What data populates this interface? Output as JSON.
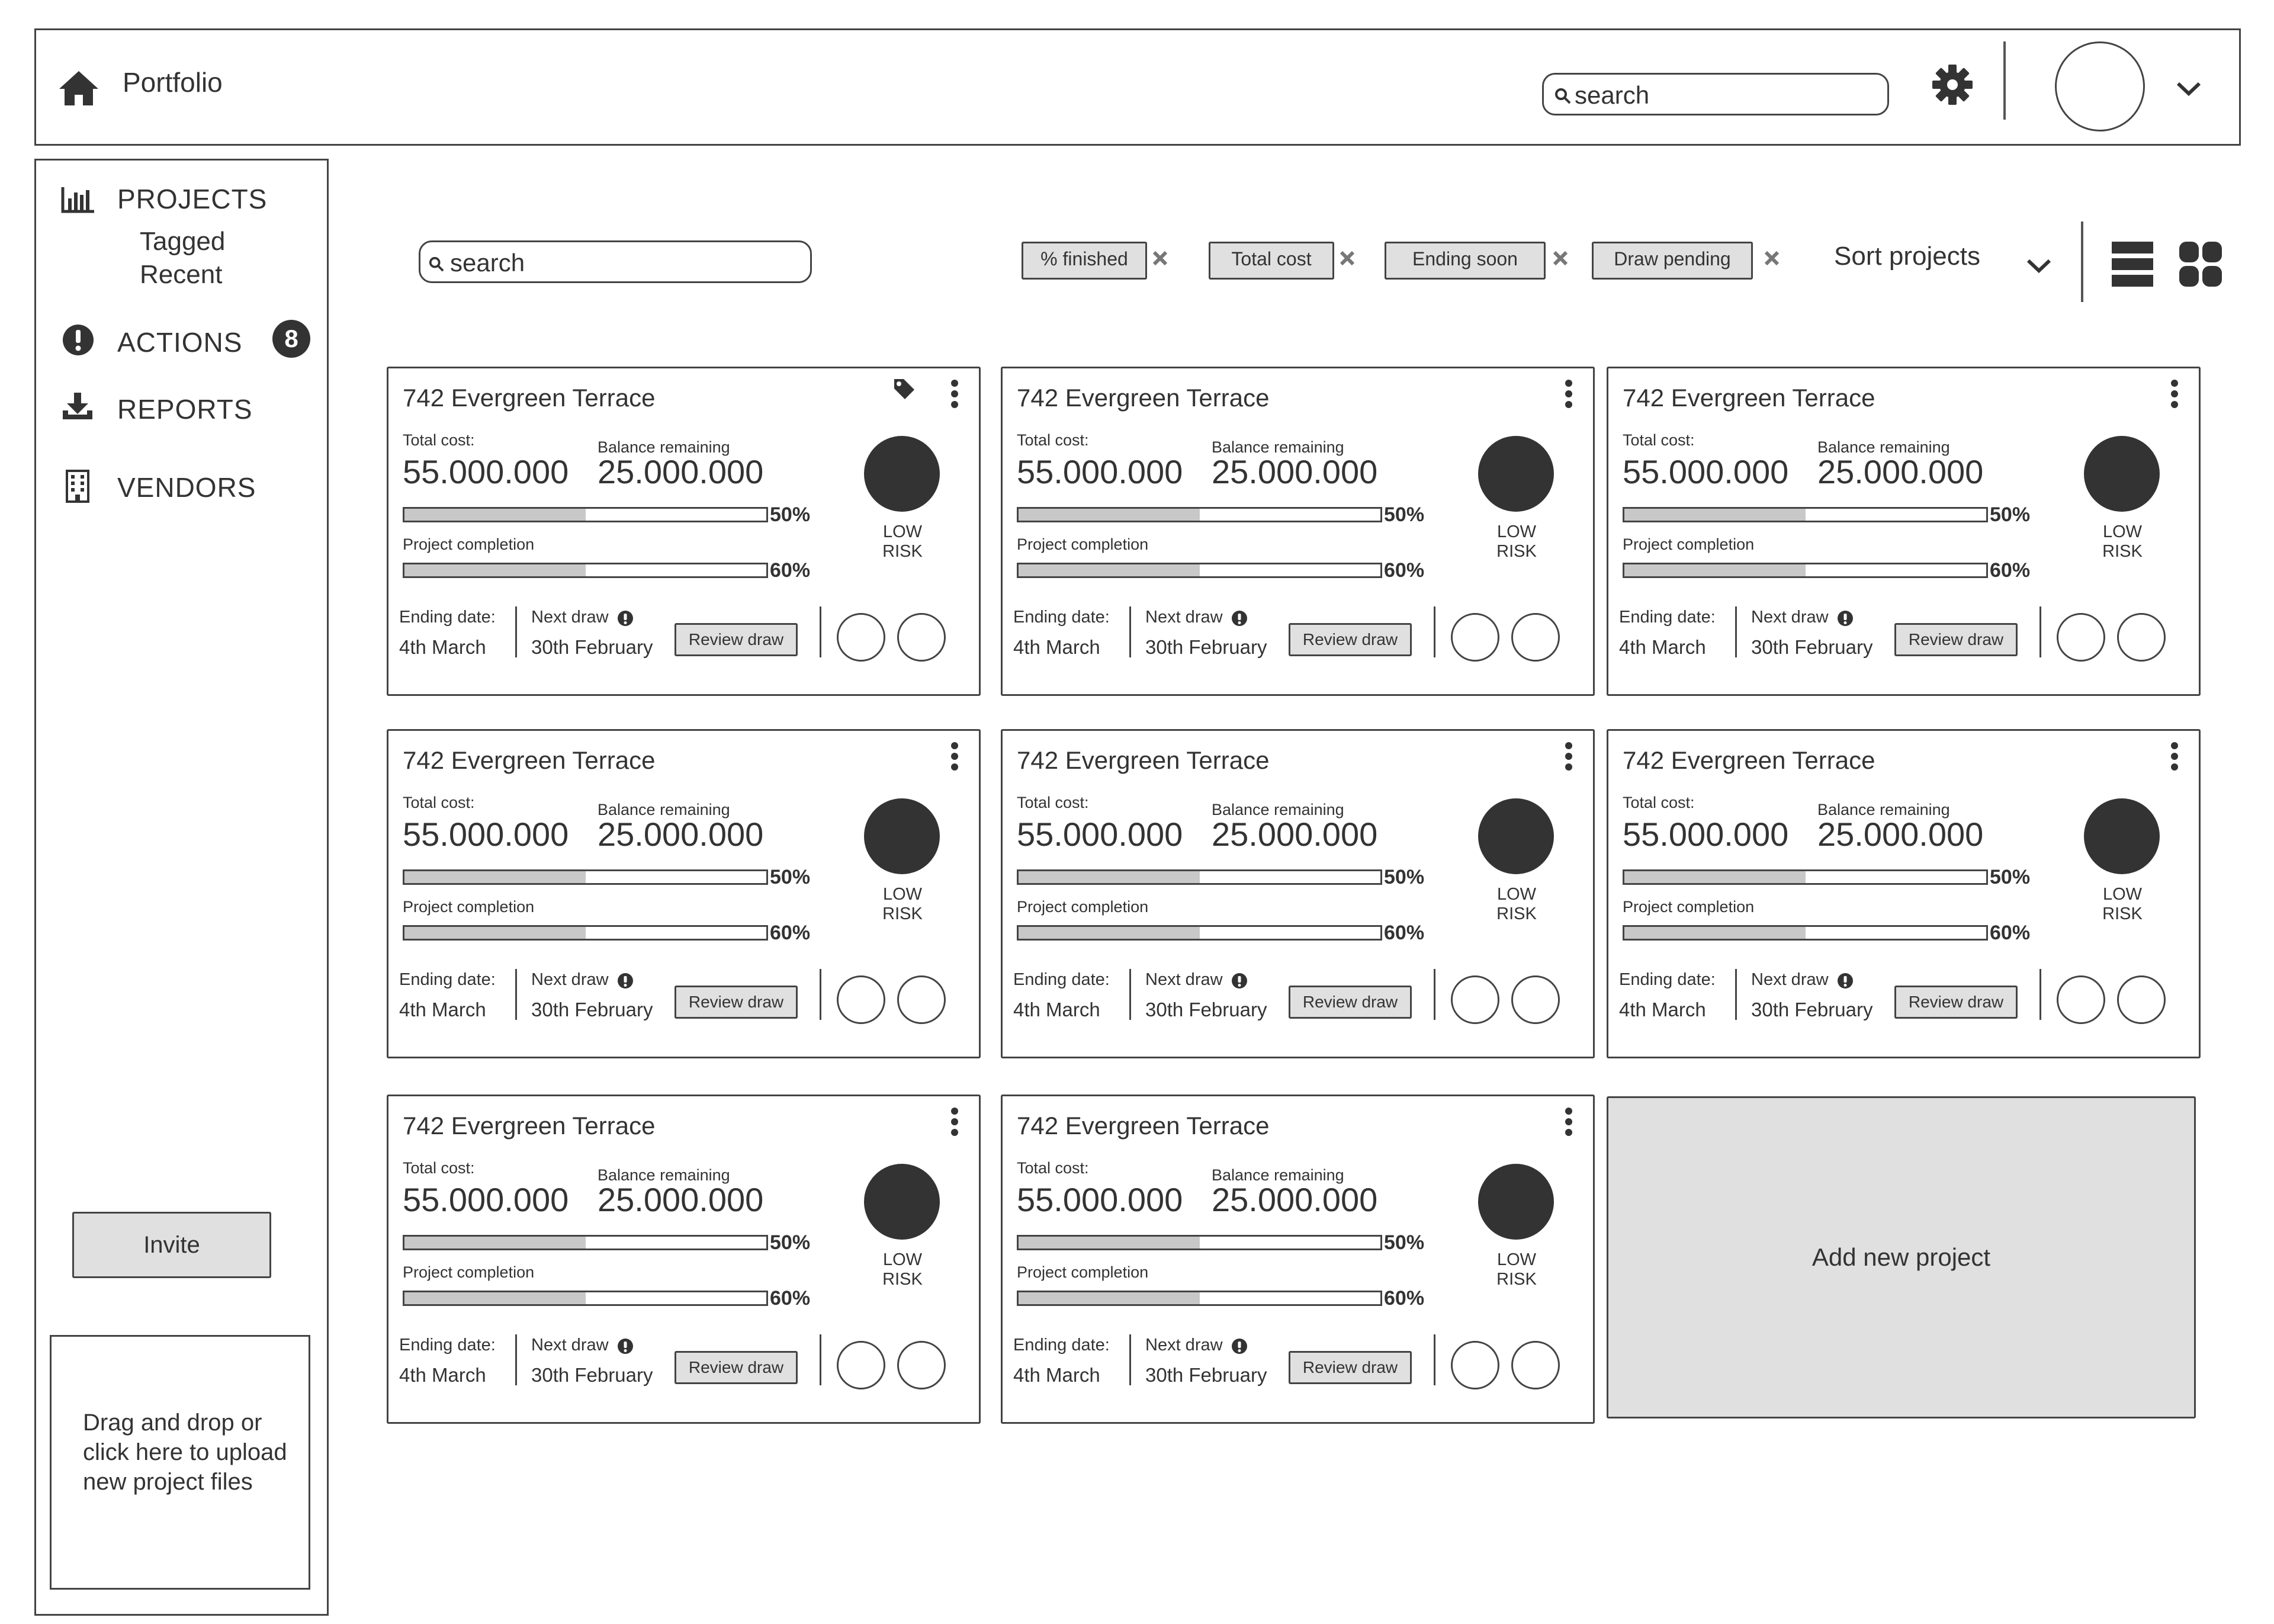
{
  "header": {
    "title": "Portfolio",
    "search_placeholder": "search",
    "icons": {
      "home": "home-icon",
      "settings": "gear-icon",
      "user": "avatar",
      "menu": "chevron-down-icon"
    }
  },
  "sidebar": {
    "items": [
      {
        "label": "PROJECTS",
        "icon": "bar-chart-icon",
        "sub": [
          "Tagged",
          "Recent"
        ]
      },
      {
        "label": "ACTIONS",
        "icon": "alert-icon",
        "badge": "8"
      },
      {
        "label": "REPORTS",
        "icon": "download-icon"
      },
      {
        "label": "VENDORS",
        "icon": "building-icon"
      }
    ],
    "invite_label": "Invite",
    "upload_text_lines": [
      "Drag and drop or",
      "click here to upload",
      "new project files"
    ]
  },
  "toolbar": {
    "search_placeholder": "search",
    "filters": [
      "% finished",
      "Total cost",
      "Ending soon",
      "Draw pending"
    ],
    "sort_label": "Sort projects",
    "view_icons": [
      "list-view-icon",
      "grid-view-icon"
    ]
  },
  "card_labels": {
    "total_cost": "Total cost:",
    "balance": "Balance remaining",
    "completion": "Project completion",
    "ending": "Ending date:",
    "next_draw": "Next draw",
    "review": "Review draw"
  },
  "projects": [
    {
      "title": "742 Evergreen Terrace",
      "tagged": true,
      "total_cost": "55.000.000",
      "balance": "25.000.000",
      "cost_pct": "50%",
      "cost_fill": 0.5,
      "completion_pct": "60%",
      "completion_fill": 0.5,
      "risk": "LOW RISK",
      "ending_date": "4th March",
      "next_draw": "30th February"
    },
    {
      "title": "742 Evergreen Terrace",
      "tagged": false,
      "total_cost": "55.000.000",
      "balance": "25.000.000",
      "cost_pct": "50%",
      "cost_fill": 0.5,
      "completion_pct": "60%",
      "completion_fill": 0.5,
      "risk": "LOW RISK",
      "ending_date": "4th March",
      "next_draw": "30th February"
    },
    {
      "title": "742 Evergreen Terrace",
      "tagged": false,
      "total_cost": "55.000.000",
      "balance": "25.000.000",
      "cost_pct": "50%",
      "cost_fill": 0.5,
      "completion_pct": "60%",
      "completion_fill": 0.5,
      "risk": "LOW RISK",
      "ending_date": "4th March",
      "next_draw": "30th February"
    },
    {
      "title": "742 Evergreen Terrace",
      "tagged": false,
      "total_cost": "55.000.000",
      "balance": "25.000.000",
      "cost_pct": "50%",
      "cost_fill": 0.5,
      "completion_pct": "60%",
      "completion_fill": 0.5,
      "risk": "LOW RISK",
      "ending_date": "4th March",
      "next_draw": "30th February"
    },
    {
      "title": "742 Evergreen Terrace",
      "tagged": false,
      "total_cost": "55.000.000",
      "balance": "25.000.000",
      "cost_pct": "50%",
      "cost_fill": 0.5,
      "completion_pct": "60%",
      "completion_fill": 0.5,
      "risk": "LOW RISK",
      "ending_date": "4th March",
      "next_draw": "30th February"
    },
    {
      "title": "742 Evergreen Terrace",
      "tagged": false,
      "total_cost": "55.000.000",
      "balance": "25.000.000",
      "cost_pct": "50%",
      "cost_fill": 0.5,
      "completion_pct": "60%",
      "completion_fill": 0.5,
      "risk": "LOW RISK",
      "ending_date": "4th March",
      "next_draw": "30th February"
    },
    {
      "title": "742 Evergreen Terrace",
      "tagged": false,
      "total_cost": "55.000.000",
      "balance": "25.000.000",
      "cost_pct": "50%",
      "cost_fill": 0.5,
      "completion_pct": "60%",
      "completion_fill": 0.5,
      "risk": "LOW RISK",
      "ending_date": "4th March",
      "next_draw": "30th February"
    },
    {
      "title": "742 Evergreen Terrace",
      "tagged": false,
      "total_cost": "55.000.000",
      "balance": "25.000.000",
      "cost_pct": "50%",
      "cost_fill": 0.5,
      "completion_pct": "60%",
      "completion_fill": 0.5,
      "risk": "LOW RISK",
      "ending_date": "4th March",
      "next_draw": "30th February"
    }
  ],
  "add_project_label": "Add new project",
  "colors": {
    "fill_dark": "#333333",
    "button_gray": "#e0e0e0",
    "bar_fill": "#c8c8c8",
    "border": "#444444"
  }
}
